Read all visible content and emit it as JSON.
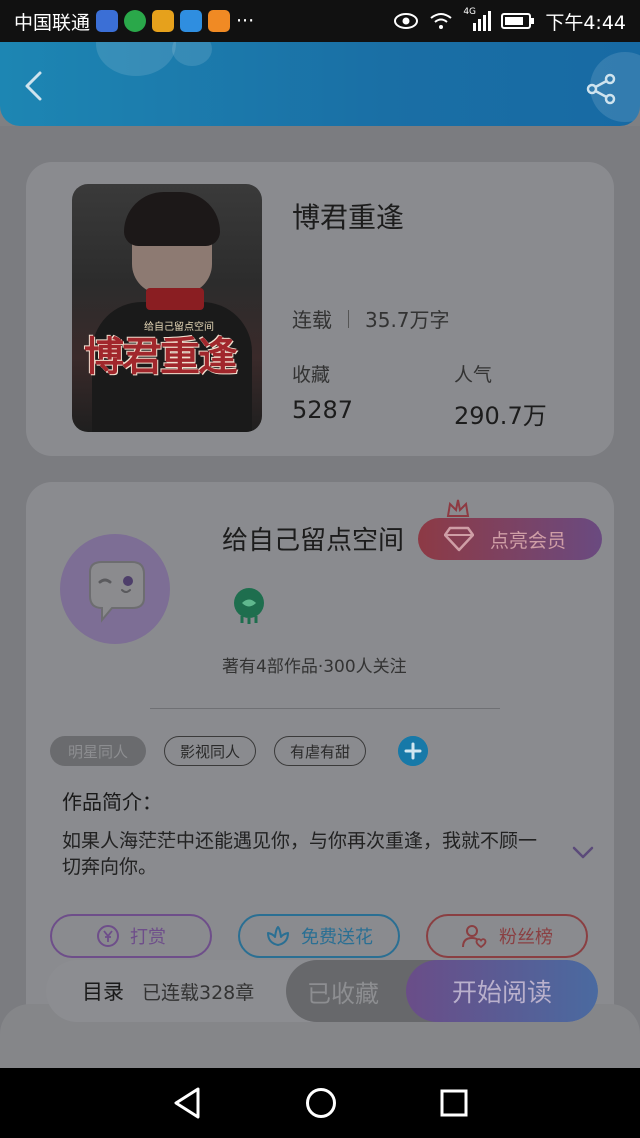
{
  "status_bar": {
    "carrier": "中国联通",
    "more": "···",
    "network": "4G",
    "time": "下午4:44"
  },
  "book": {
    "title": "博君重逢",
    "status": "连载",
    "word_count": "35.7万字",
    "collect_label": "收藏",
    "collect_value": "5287",
    "popularity_label": "人气",
    "popularity_value": "290.7万",
    "cover_title": "博君重逢",
    "cover_subtitle": "给自己留点空间"
  },
  "author": {
    "name": "给自己留点空间",
    "vip_label": "点亮会员",
    "works_info": "著有4部作品·300人关注"
  },
  "tags": [
    "明星同人",
    "影视同人",
    "有虐有甜"
  ],
  "intro": {
    "title": "作品简介：",
    "text": "如果人海茫茫中还能遇见你，与你再次重逢，我就不顾一切奔向你。"
  },
  "actions": {
    "reward": "打赏",
    "flower": "免费送花",
    "fans": "粉丝榜"
  },
  "bottom_bar": {
    "toc_label": "目录",
    "toc_count": "已连载328章",
    "favorited": "已收藏",
    "start_reading": "开始阅读"
  },
  "colors": {
    "header_blue": "#1a6fa5",
    "accent_purple": "#6e4e8a",
    "accent_teal": "#2a6f93",
    "accent_red": "#8a3f42"
  }
}
